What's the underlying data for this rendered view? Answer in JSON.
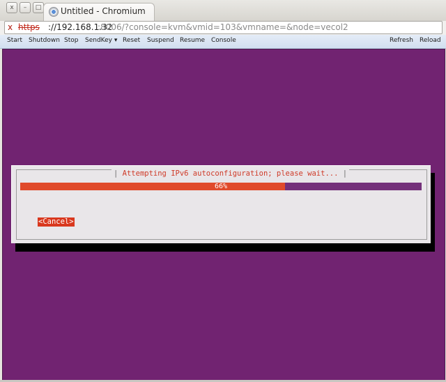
{
  "window": {
    "title": "Untitled - Chromium",
    "buttons": {
      "close": "x",
      "minimize": "–",
      "maximize": "□"
    }
  },
  "tab": {
    "title": "Untitled - Chromium",
    "icon": "page-loading-icon"
  },
  "url": {
    "warning_icon": "x",
    "scheme": "https",
    "host": "://192.168.1.32",
    "rest": ":8006/?console=kvm&vmid=103&vmname=&node=vecol2"
  },
  "toolbar": {
    "start": "Start",
    "shutdown": "Shutdown",
    "stop": "Stop",
    "sendkey": "SendKey ▾",
    "reset": "Reset",
    "suspend": "Suspend",
    "resume": "Resume",
    "console": "Console",
    "refresh": "Refresh",
    "reload": "Reload"
  },
  "dialog": {
    "title_left": "| ",
    "title": "Attempting IPv6 autoconfiguration; please wait...",
    "title_right": " |",
    "progress_text": "66%",
    "progress_fraction": 0.66,
    "cancel_label": "<Cancel>"
  },
  "colors": {
    "console_bg": "#712371",
    "progress_fill": "#e04a2b",
    "progress_track": "#74307a",
    "title_text": "#cf3a28",
    "cancel_bg": "#d9381e",
    "toolbar_bg": "#dce6f3"
  }
}
